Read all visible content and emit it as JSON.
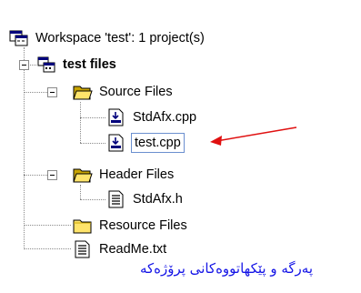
{
  "tree": {
    "workspace": {
      "label": "Workspace 'test': 1 project(s)",
      "icon": "workspace-icon"
    },
    "project": {
      "label": "test files",
      "icon": "project-icon"
    },
    "source_files": {
      "label": "Source Files",
      "icon": "folder-open-icon"
    },
    "stdafx_cpp": {
      "label": "StdAfx.cpp",
      "icon": "cpp-file-icon"
    },
    "test_cpp": {
      "label": "test.cpp",
      "icon": "cpp-file-icon"
    },
    "header_files": {
      "label": "Header Files",
      "icon": "folder-open-icon"
    },
    "stdafx_h": {
      "label": "StdAfx.h",
      "icon": "header-file-icon"
    },
    "resource_files": {
      "label": "Resource Files",
      "icon": "folder-icon"
    },
    "readme": {
      "label": "ReadMe.txt",
      "icon": "text-file-icon"
    }
  },
  "annotation": {
    "caption": "پەرگە و پێکهاتووەکانی پرۆژەکە",
    "caption_color": "#1414e6",
    "arrow_color": "#e01010"
  }
}
